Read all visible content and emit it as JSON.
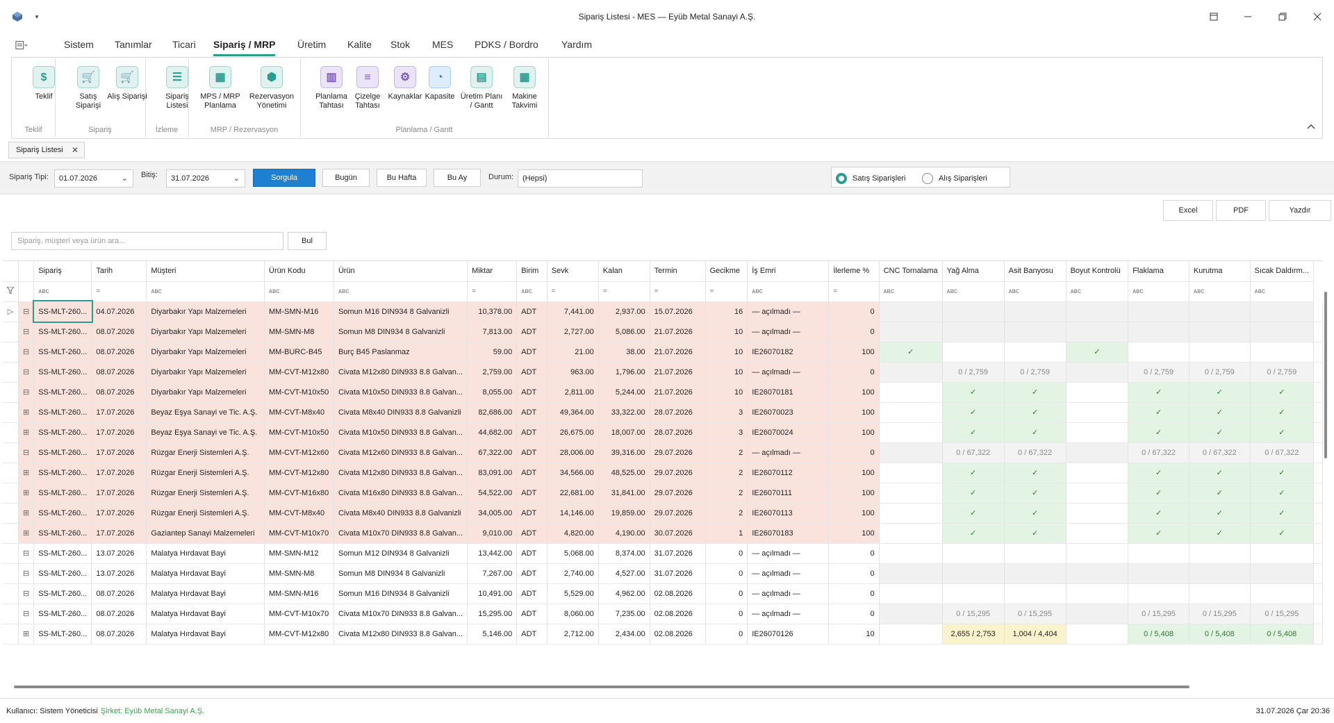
{
  "window": {
    "title": "Sipariş Listesi - MES — Eyüb Metal Sanayi A.Ş."
  },
  "menu": [
    "Sistem",
    "Tanımlar",
    "Ticari",
    "Sipariş / MRP",
    "Üretim",
    "Kalite",
    "Stok",
    "MES",
    "PDKS / Bordro",
    "Yardım"
  ],
  "ribbon": {
    "buttons": [
      "Teklif",
      "Satış\nSiparişi",
      "Alış Siparişi",
      "Sipariş\nListesi",
      "MPS / MRP\nPlanlama",
      "Rezervasyon\nYönetimi",
      "Planlama\nTahtası",
      "Çizelge\nTahtası",
      "Kaynaklar",
      "Kapasite",
      "Üretim Planı\n/ Gantt",
      "Makine\nTakvimi"
    ],
    "groups": [
      "Teklif",
      "Sipariş",
      "İzleme",
      "MRP / Rezervasyon",
      "Planlama / Gantt"
    ]
  },
  "doc_tab": "Sipariş Listesi",
  "filter": {
    "siparis_tipi_label": "Sipariş Tipi:",
    "start_date": "01.07.2026",
    "bitis_label": "Bitiş:",
    "end_date": "31.07.2026",
    "sorgula": "Sorgula",
    "bugun": "Bugün",
    "bu_hafta": "Bu Hafta",
    "bu_ay": "Bu Ay",
    "durum_label": "Durum:",
    "durum_value": "(Hepsi)",
    "radio_satis": "Satış Siparişleri",
    "radio_alis": "Alış Siparişleri"
  },
  "export": {
    "excel": "Excel",
    "pdf": "PDF",
    "yazdir": "Yazdır"
  },
  "search": {
    "placeholder": "Sipariş, müşteri veya ürün ara...",
    "button": "Bul"
  },
  "columns": [
    "Sipariş",
    "Tarih",
    "Müşteri",
    "Ürün Kodu",
    "Ürün",
    "Miktar",
    "Birim",
    "Sevk",
    "Kalan",
    "Termin",
    "Gecikme",
    "İş Emri",
    "İlerleme %",
    "CNC Tornalama",
    "Yağ Alma",
    "Asit Banyosu",
    "Boyut Kontrolü",
    "Flaklama",
    "Kurutma",
    "Sıcak Daldırm..."
  ],
  "rows": [
    {
      "siparis": "SS-MLT-260...",
      "tarih": "04.07.2026",
      "musteri": "Diyarbakır Yapı Malzemeleri",
      "kod": "MM-SMN-M16",
      "urun": "Somun M16 DIN934 8 Galvanizli",
      "miktar": "10,378.00",
      "birim": "ADT",
      "sevk": "7,441.00",
      "kalan": "2,937.00",
      "termin": "15.07.2026",
      "gecikme": "16",
      "is_emri": "— açılmadı —",
      "ilerleme": "0",
      "st": [
        "g",
        "g",
        "g",
        "g",
        "g",
        "g",
        "g"
      ],
      "late": true,
      "exp": "⊟",
      "ind": "▷"
    },
    {
      "siparis": "SS-MLT-260...",
      "tarih": "08.07.2026",
      "musteri": "Diyarbakır Yapı Malzemeleri",
      "kod": "MM-SMN-M8",
      "urun": "Somun M8 DIN934 8 Galvanizli",
      "miktar": "7,813.00",
      "birim": "ADT",
      "sevk": "2,727.00",
      "kalan": "5,086.00",
      "termin": "21.07.2026",
      "gecikme": "10",
      "is_emri": "— açılmadı —",
      "ilerleme": "0",
      "st": [
        "g",
        "g",
        "g",
        "g",
        "g",
        "g",
        "g"
      ],
      "late": true,
      "exp": "⊟",
      "ind": ""
    },
    {
      "siparis": "SS-MLT-260...",
      "tarih": "08.07.2026",
      "musteri": "Diyarbakır Yapı Malzemeleri",
      "kod": "MM-BURC-B45",
      "urun": "Burç B45 Paslanmaz",
      "miktar": "59.00",
      "birim": "ADT",
      "sevk": "21.00",
      "kalan": "38.00",
      "termin": "21.07.2026",
      "gecikme": "10",
      "is_emri": "IE26070182",
      "ilerleme": "100",
      "st": [
        "ok",
        "e",
        "e",
        "ok",
        "e",
        "e",
        "e"
      ],
      "late": true,
      "exp": "⊟",
      "ind": ""
    },
    {
      "siparis": "SS-MLT-260...",
      "tarih": "08.07.2026",
      "musteri": "Diyarbakır Yapı Malzemeleri",
      "kod": "MM-CVT-M12x80",
      "urun": "Civata M12x80 DIN933 8.8 Galvan...",
      "miktar": "2,759.00",
      "birim": "ADT",
      "sevk": "963.00",
      "kalan": "1,796.00",
      "termin": "21.07.2026",
      "gecikme": "10",
      "is_emri": "— açılmadı —",
      "ilerleme": "0",
      "st": [
        "g",
        "p:0 / 2,759",
        "p:0 / 2,759",
        "g",
        "p:0 / 2,759",
        "p:0 / 2,759",
        "p:0 / 2,759"
      ],
      "late": true,
      "exp": "⊟",
      "ind": ""
    },
    {
      "siparis": "SS-MLT-260...",
      "tarih": "08.07.2026",
      "musteri": "Diyarbakır Yapı Malzemeleri",
      "kod": "MM-CVT-M10x50",
      "urun": "Civata M10x50 DIN933 8.8 Galvan...",
      "miktar": "8,055.00",
      "birim": "ADT",
      "sevk": "2,811.00",
      "kalan": "5,244.00",
      "termin": "21.07.2026",
      "gecikme": "10",
      "is_emri": "IE26070181",
      "ilerleme": "100",
      "st": [
        "e",
        "ok",
        "ok",
        "e",
        "ok",
        "ok",
        "ok"
      ],
      "late": true,
      "exp": "⊟",
      "ind": ""
    },
    {
      "siparis": "SS-MLT-260...",
      "tarih": "17.07.2026",
      "musteri": "Beyaz Eşya Sanayi ve Tic. A.Ş.",
      "kod": "MM-CVT-M8x40",
      "urun": "Civata M8x40 DIN933 8.8 Galvanizli",
      "miktar": "82,686.00",
      "birim": "ADT",
      "sevk": "49,364.00",
      "kalan": "33,322.00",
      "termin": "28.07.2026",
      "gecikme": "3",
      "is_emri": "IE26070023",
      "ilerleme": "100",
      "st": [
        "e",
        "ok",
        "ok",
        "e",
        "ok",
        "ok",
        "ok"
      ],
      "late": true,
      "exp": "⊞",
      "ind": ""
    },
    {
      "siparis": "SS-MLT-260...",
      "tarih": "17.07.2026",
      "musteri": "Beyaz Eşya Sanayi ve Tic. A.Ş.",
      "kod": "MM-CVT-M10x50",
      "urun": "Civata M10x50 DIN933 8.8 Galvan...",
      "miktar": "44,682.00",
      "birim": "ADT",
      "sevk": "26,675.00",
      "kalan": "18,007.00",
      "termin": "28.07.2026",
      "gecikme": "3",
      "is_emri": "IE26070024",
      "ilerleme": "100",
      "st": [
        "e",
        "ok",
        "ok",
        "e",
        "ok",
        "ok",
        "ok"
      ],
      "late": true,
      "exp": "⊞",
      "ind": ""
    },
    {
      "siparis": "SS-MLT-260...",
      "tarih": "17.07.2026",
      "musteri": "Rüzgar Enerji Sistemleri A.Ş.",
      "kod": "MM-CVT-M12x60",
      "urun": "Civata M12x60 DIN933 8.8 Galvan...",
      "miktar": "67,322.00",
      "birim": "ADT",
      "sevk": "28,006.00",
      "kalan": "39,316.00",
      "termin": "29.07.2026",
      "gecikme": "2",
      "is_emri": "— açılmadı —",
      "ilerleme": "0",
      "st": [
        "g",
        "p:0 / 67,322",
        "p:0 / 67,322",
        "g",
        "p:0 / 67,322",
        "p:0 / 67,322",
        "p:0 / 67,322"
      ],
      "late": true,
      "exp": "⊟",
      "ind": ""
    },
    {
      "siparis": "SS-MLT-260...",
      "tarih": "17.07.2026",
      "musteri": "Rüzgar Enerji Sistemleri A.Ş.",
      "kod": "MM-CVT-M12x80",
      "urun": "Civata M12x80 DIN933 8.8 Galvan...",
      "miktar": "83,091.00",
      "birim": "ADT",
      "sevk": "34,566.00",
      "kalan": "48,525.00",
      "termin": "29.07.2026",
      "gecikme": "2",
      "is_emri": "IE26070112",
      "ilerleme": "100",
      "st": [
        "e",
        "ok",
        "ok",
        "e",
        "ok",
        "ok",
        "ok"
      ],
      "late": true,
      "exp": "⊞",
      "ind": ""
    },
    {
      "siparis": "SS-MLT-260...",
      "tarih": "17.07.2026",
      "musteri": "Rüzgar Enerji Sistemleri A.Ş.",
      "kod": "MM-CVT-M16x80",
      "urun": "Civata M16x80 DIN933 8.8 Galvan...",
      "miktar": "54,522.00",
      "birim": "ADT",
      "sevk": "22,681.00",
      "kalan": "31,841.00",
      "termin": "29.07.2026",
      "gecikme": "2",
      "is_emri": "IE26070111",
      "ilerleme": "100",
      "st": [
        "e",
        "ok",
        "ok",
        "e",
        "ok",
        "ok",
        "ok"
      ],
      "late": true,
      "exp": "⊞",
      "ind": ""
    },
    {
      "siparis": "SS-MLT-260...",
      "tarih": "17.07.2026",
      "musteri": "Rüzgar Enerji Sistemleri A.Ş.",
      "kod": "MM-CVT-M8x40",
      "urun": "Civata M8x40 DIN933 8.8 Galvanizli",
      "miktar": "34,005.00",
      "birim": "ADT",
      "sevk": "14,146.00",
      "kalan": "19,859.00",
      "termin": "29.07.2026",
      "gecikme": "2",
      "is_emri": "IE26070113",
      "ilerleme": "100",
      "st": [
        "e",
        "ok",
        "ok",
        "e",
        "ok",
        "ok",
        "ok"
      ],
      "late": true,
      "exp": "⊞",
      "ind": ""
    },
    {
      "siparis": "SS-MLT-260...",
      "tarih": "17.07.2026",
      "musteri": "Gaziantep Sanayi Malzemeleri",
      "kod": "MM-CVT-M10x70",
      "urun": "Civata M10x70 DIN933 8.8 Galvan...",
      "miktar": "9,010.00",
      "birim": "ADT",
      "sevk": "4,820.00",
      "kalan": "4,190.00",
      "termin": "30.07.2026",
      "gecikme": "1",
      "is_emri": "IE26070183",
      "ilerleme": "100",
      "st": [
        "e",
        "ok",
        "ok",
        "e",
        "ok",
        "ok",
        "ok"
      ],
      "late": true,
      "exp": "⊞",
      "ind": ""
    },
    {
      "siparis": "SS-MLT-260...",
      "tarih": "13.07.2026",
      "musteri": "Malatya Hırdavat Bayi",
      "kod": "MM-SMN-M12",
      "urun": "Somun M12 DIN934 8 Galvanizli",
      "miktar": "13,442.00",
      "birim": "ADT",
      "sevk": "5,068.00",
      "kalan": "8,374.00",
      "termin": "31.07.2026",
      "gecikme": "0",
      "is_emri": "— açılmadı —",
      "ilerleme": "0",
      "st": [
        "e",
        "e",
        "e",
        "e",
        "e",
        "e",
        "e"
      ],
      "late": false,
      "exp": "⊟",
      "ind": ""
    },
    {
      "siparis": "SS-MLT-260...",
      "tarih": "13.07.2026",
      "musteri": "Malatya Hırdavat Bayi",
      "kod": "MM-SMN-M8",
      "urun": "Somun M8 DIN934 8 Galvanizli",
      "miktar": "7,267.00",
      "birim": "ADT",
      "sevk": "2,740.00",
      "kalan": "4,527.00",
      "termin": "31.07.2026",
      "gecikme": "0",
      "is_emri": "— açılmadı —",
      "ilerleme": "0",
      "st": [
        "g",
        "g",
        "g",
        "g",
        "g",
        "g",
        "g"
      ],
      "late": false,
      "exp": "⊟",
      "ind": ""
    },
    {
      "siparis": "SS-MLT-260...",
      "tarih": "08.07.2026",
      "musteri": "Malatya Hırdavat Bayi",
      "kod": "MM-SMN-M16",
      "urun": "Somun M16 DIN934 8 Galvanizli",
      "miktar": "10,491.00",
      "birim": "ADT",
      "sevk": "5,529.00",
      "kalan": "4,962.00",
      "termin": "02.08.2026",
      "gecikme": "0",
      "is_emri": "— açılmadı —",
      "ilerleme": "0",
      "st": [
        "e",
        "e",
        "e",
        "e",
        "e",
        "e",
        "e"
      ],
      "late": false,
      "exp": "⊟",
      "ind": ""
    },
    {
      "siparis": "SS-MLT-260...",
      "tarih": "08.07.2026",
      "musteri": "Malatya Hırdavat Bayi",
      "kod": "MM-CVT-M10x70",
      "urun": "Civata M10x70 DIN933 8.8 Galvan...",
      "miktar": "15,295.00",
      "birim": "ADT",
      "sevk": "8,060.00",
      "kalan": "7,235.00",
      "termin": "02.08.2026",
      "gecikme": "0",
      "is_emri": "— açılmadı —",
      "ilerleme": "0",
      "st": [
        "g",
        "p:0 / 15,295",
        "p:0 / 15,295",
        "g",
        "p:0 / 15,295",
        "p:0 / 15,295",
        "p:0 / 15,295"
      ],
      "late": false,
      "exp": "⊟",
      "ind": ""
    },
    {
      "siparis": "SS-MLT-260...",
      "tarih": "08.07.2026",
      "musteri": "Malatya Hırdavat Bayi",
      "kod": "MM-CVT-M12x80",
      "urun": "Civata M12x80 DIN933 8.8 Galvan...",
      "miktar": "5,146.00",
      "birim": "ADT",
      "sevk": "2,712.00",
      "kalan": "2,434.00",
      "termin": "02.08.2026",
      "gecikme": "0",
      "is_emri": "IE26070126",
      "ilerleme": "10",
      "st": [
        "e",
        "y:2,655 / 2,753",
        "y:1,004 / 4,404",
        "e",
        "ok:0 / 5,408",
        "ok:0 / 5,408",
        "ok:0 / 5,408"
      ],
      "late": false,
      "exp": "⊞",
      "ind": ""
    }
  ],
  "status": {
    "user": "Kullanıcı: Sistem Yöneticisi",
    "company": "Şirket: Eyüb Metal Sanayi A.Ş.",
    "datetime": "31.07.2026 Çar 20:36"
  },
  "colors": {
    "accent": "#2b9c8e",
    "primary_button": "#1f7fd1",
    "late_row": "#fbe3dd",
    "done_cell": "#e4f4e4",
    "partial_cell": "#fbf3cc",
    "company_text": "#3aa648"
  }
}
